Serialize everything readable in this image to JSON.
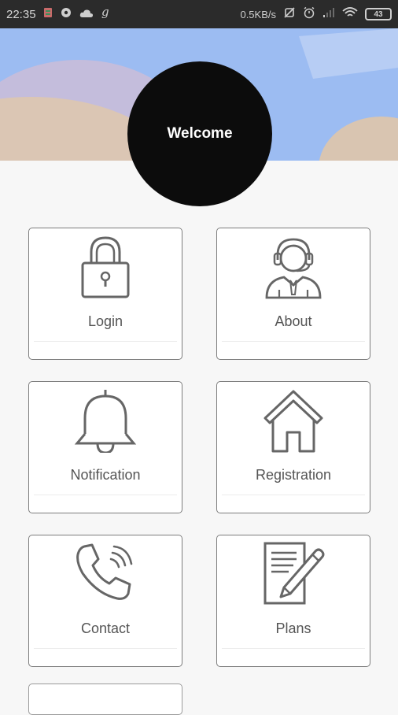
{
  "status_bar": {
    "time": "22:35",
    "network_speed": "0.5KB/s",
    "battery": "43"
  },
  "header": {
    "welcome_text": "Welcome"
  },
  "menu": {
    "items": [
      {
        "label": "Login",
        "icon": "lock-icon"
      },
      {
        "label": "About",
        "icon": "support-agent-icon"
      },
      {
        "label": "Notification",
        "icon": "bell-icon"
      },
      {
        "label": "Registration",
        "icon": "home-icon"
      },
      {
        "label": "Contact",
        "icon": "phone-icon"
      },
      {
        "label": "Plans",
        "icon": "document-pencil-icon"
      }
    ]
  },
  "colors": {
    "header_sky": "#9cbcf2",
    "header_sand": "#d8c7b6",
    "avatar_bg": "#0c0c0c",
    "card_border": "#7d7d7d",
    "icon_stroke": "#666666"
  }
}
